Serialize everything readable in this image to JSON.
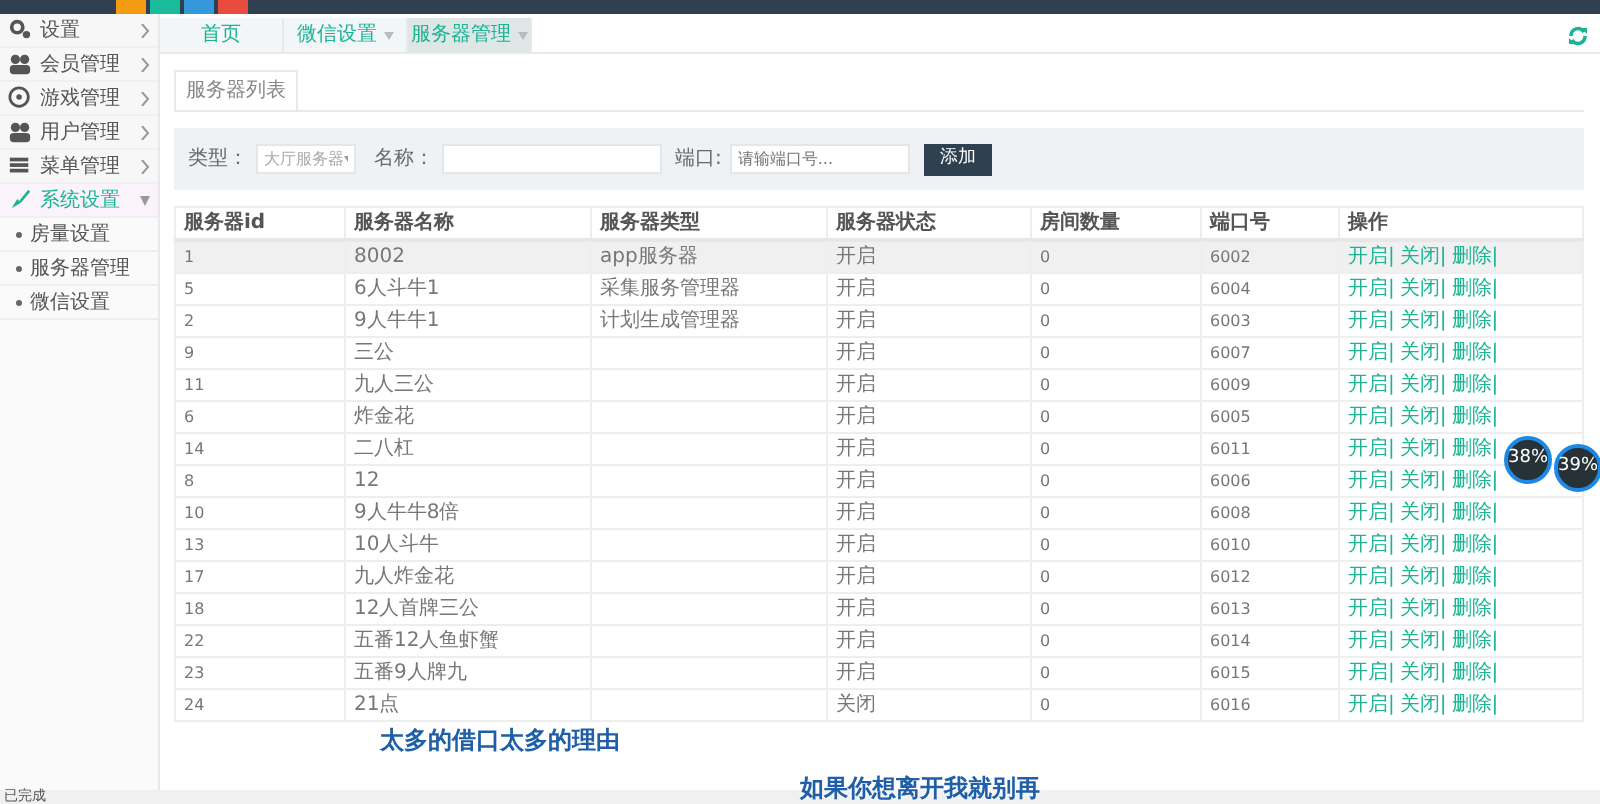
{
  "top_bar": {
    "skins": [
      {
        "color": "#f39c12"
      },
      {
        "color": "#1abc9c"
      },
      {
        "color": "#3498db"
      },
      {
        "color": "#e74c3c"
      }
    ]
  },
  "sidebar": {
    "items": [
      {
        "label": "设置",
        "selected": false,
        "expanded": false
      },
      {
        "label": "会员管理",
        "selected": false,
        "expanded": false
      },
      {
        "label": "游戏管理",
        "selected": false,
        "expanded": false
      },
      {
        "label": "用户管理",
        "selected": false,
        "expanded": false
      },
      {
        "label": "菜单管理",
        "selected": false,
        "expanded": false
      },
      {
        "label": "系统设置",
        "selected": true,
        "expanded": true,
        "children": [
          {
            "label": "房量设置"
          },
          {
            "label": "服务器管理"
          },
          {
            "label": "微信设置"
          }
        ]
      }
    ]
  },
  "page_tabs": [
    {
      "label": "首页",
      "selected": false,
      "closable": false
    },
    {
      "label": "微信设置",
      "selected": false,
      "closable": true
    },
    {
      "label": "服务器管理",
      "selected": true,
      "closable": true
    }
  ],
  "panel_tab": "服务器列表",
  "filter": {
    "type_label": "类型：",
    "type_value": "大厅服务器",
    "name_label": "名称：",
    "port_label": "端口:",
    "port_placeholder": "请输端口号...",
    "add_button": "添加"
  },
  "table": {
    "columns": [
      "服务器id",
      "服务器名称",
      "服务器类型",
      "服务器状态",
      "房间数量",
      "端口号",
      "操作"
    ],
    "rows": [
      {
        "id": "1",
        "name": "8002",
        "type": "app服务器",
        "status": "开启",
        "rooms": "0",
        "port": "6002",
        "actions": [
          "开启|",
          "关闭|",
          "删除|"
        ],
        "selected": true
      },
      {
        "id": "5",
        "name": "6人斗牛1",
        "type": "采集服务管理器",
        "status": "开启",
        "rooms": "0",
        "port": "6004",
        "actions": [
          "开启|",
          "关闭|",
          "删除|"
        ],
        "selected": false
      },
      {
        "id": "2",
        "name": "9人牛牛1",
        "type": "计划生成管理器",
        "status": "开启",
        "rooms": "0",
        "port": "6003",
        "actions": [
          "开启|",
          "关闭|",
          "删除|"
        ],
        "selected": false
      },
      {
        "id": "9",
        "name": "三公",
        "type": "",
        "status": "开启",
        "rooms": "0",
        "port": "6007",
        "actions": [
          "开启|",
          "关闭|",
          "删除|"
        ],
        "selected": false
      },
      {
        "id": "11",
        "name": "九人三公",
        "type": "",
        "status": "开启",
        "rooms": "0",
        "port": "6009",
        "actions": [
          "开启|",
          "关闭|",
          "删除|"
        ],
        "selected": false
      },
      {
        "id": "6",
        "name": "炸金花",
        "type": "",
        "status": "开启",
        "rooms": "0",
        "port": "6005",
        "actions": [
          "开启|",
          "关闭|",
          "删除|"
        ],
        "selected": false
      },
      {
        "id": "14",
        "name": "二八杠",
        "type": "",
        "status": "开启",
        "rooms": "0",
        "port": "6011",
        "actions": [
          "开启|",
          "关闭|",
          "删除|"
        ],
        "selected": false
      },
      {
        "id": "8",
        "name": "12",
        "type": "",
        "status": "开启",
        "rooms": "0",
        "port": "6006",
        "actions": [
          "开启|",
          "关闭|",
          "删除|"
        ],
        "selected": false
      },
      {
        "id": "10",
        "name": "9人牛牛8倍",
        "type": "",
        "status": "开启",
        "rooms": "0",
        "port": "6008",
        "actions": [
          "开启|",
          "关闭|",
          "删除|"
        ],
        "selected": false
      },
      {
        "id": "13",
        "name": "10人斗牛",
        "type": "",
        "status": "开启",
        "rooms": "0",
        "port": "6010",
        "actions": [
          "开启|",
          "关闭|",
          "删除|"
        ],
        "selected": false
      },
      {
        "id": "17",
        "name": "九人炸金花",
        "type": "",
        "status": "开启",
        "rooms": "0",
        "port": "6012",
        "actions": [
          "开启|",
          "关闭|",
          "删除|"
        ],
        "selected": false
      },
      {
        "id": "18",
        "name": "12人首牌三公",
        "type": "",
        "status": "开启",
        "rooms": "0",
        "port": "6013",
        "actions": [
          "开启|",
          "关闭|",
          "删除|"
        ],
        "selected": false
      },
      {
        "id": "22",
        "name": "五番12人鱼虾蟹",
        "type": "",
        "status": "开启",
        "rooms": "0",
        "port": "6014",
        "actions": [
          "开启|",
          "关闭|",
          "删除|"
        ],
        "selected": false
      },
      {
        "id": "23",
        "name": "五番9人牌九",
        "type": "",
        "status": "开启",
        "rooms": "0",
        "port": "6015",
        "actions": [
          "开启|",
          "关闭|",
          "删除|"
        ],
        "selected": false
      },
      {
        "id": "24",
        "name": "21点",
        "type": "",
        "status": "关闭",
        "rooms": "0",
        "port": "6016",
        "actions": [
          "开启|",
          "关闭|",
          "删除|"
        ],
        "selected": false
      }
    ]
  },
  "monitor_widget": {
    "readings": [
      "38%",
      "39%"
    ]
  },
  "subtitles": [
    "太多的借口太多的理由",
    "如果你想离开我就别再"
  ],
  "status_bar": "已完成"
}
